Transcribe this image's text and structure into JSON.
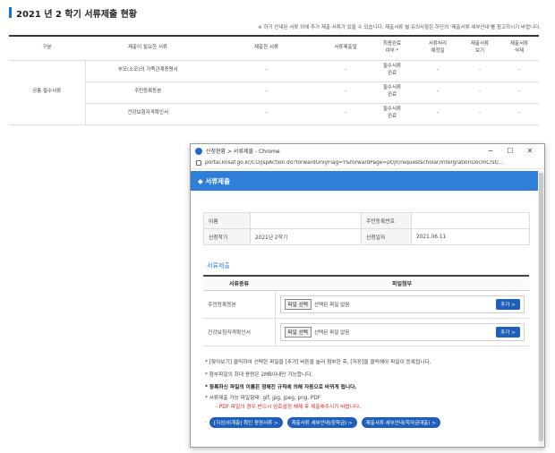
{
  "section": {
    "title": "2021 년 2 학기 서류제출 현황"
  },
  "notice": "※ 하기 안내된 서류 외에 추가 제출 서류가 있을 수 있습니다. 제출서류 별 유의사항은 하단의 '제출서류 세부안내'를 참고하시기 바랍니다.",
  "main_table": {
    "headers": [
      "구분",
      "제출이 필요한 서류",
      "제출한 서류",
      "서류제출일",
      "최종완료\n여부 *",
      "서류처리\n예정일",
      "제출서류\n보기",
      "제출서류\n삭제"
    ],
    "group": "공통 필수서류",
    "rows": [
      {
        "doc": "부모(소모)의 가족관계증명서",
        "submitted": "-",
        "date": "-",
        "status": "필수서류\n완료",
        "due": "-",
        "view": "-",
        "del": "-"
      },
      {
        "doc": "주민등록등본",
        "submitted": "-",
        "date": "-",
        "status": "필수서류\n완료",
        "due": "-",
        "view": "-",
        "del": "-"
      },
      {
        "doc": "건강보험자격확인서",
        "submitted": "-",
        "date": "-",
        "status": "필수서류\n완료",
        "due": "-",
        "view": "-",
        "del": "-"
      }
    ]
  },
  "popup": {
    "window_title": "신청현황 > 서류제출 - Chrome",
    "url": "portal.kosaf.go.kr/CO/jspAction.do?forwardOnlyFlag=Y&forwardPage=pt/jh/requestscholar/intergrationDocmCrst/...",
    "minimize": "−",
    "maximize": "☐",
    "close": "✕",
    "header": "◆ 서류제출",
    "info": {
      "name_label": "이름",
      "name_value": "",
      "rrn_label": "주민등록번호",
      "rrn_value": "",
      "term_label": "신청학기",
      "term_value": "2021년 2학기",
      "date_label": "신청일자",
      "date_value": "2021.06.11"
    },
    "sub_title": "서류제출",
    "file_headers": [
      "서류종류",
      "파일첨부"
    ],
    "files": [
      {
        "name": "주민등록등본",
        "choose": "파일 선택",
        "none": "선택된 파일 없음",
        "add": "추가 >"
      },
      {
        "name": "건강보험자격확인서",
        "choose": "파일 선택",
        "none": "선택된 파일 없음",
        "add": "추가 >"
      }
    ],
    "notes": [
      "* [찾아보기] 클릭하여 선택한 파일을 [추가] 버튼을 눌러 첨부한 후, [저장]을 클릭해야 파일이 등록됩니다.",
      "* 첨부파일의 최대 용량은 2MB이내만 가능합니다.",
      "* 등록하신 파일의 이름은 정해진 규칙에 의해 자동으로 바뀌게 됩니다."
    ],
    "ext_note": "* 서류제출 가능 파일형태: gif, jpg, jpeg, png, PDF",
    "red_note": "- PDF 파일의 경우 반드시 암호설정 해제 후 제출해주시기 바랍니다.",
    "link_dot": "·",
    "links": [
      "[지성/위계층] 확인 증명서류 >",
      "제출서류 세부안내(장학금) >",
      "제출서류 세부안내(학자금대출) >"
    ]
  },
  "colors": {
    "accent": "#2f7fd8",
    "button": "#1f5fb8",
    "warning": "#e02020"
  }
}
